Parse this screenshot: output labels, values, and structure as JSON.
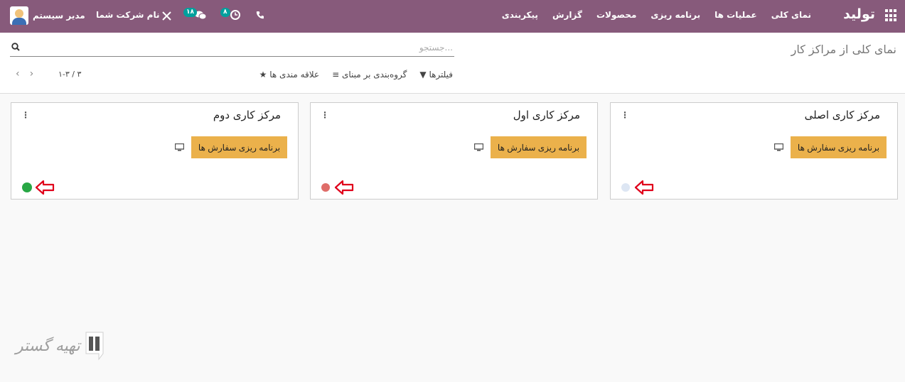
{
  "app": {
    "brand": "تولید",
    "menu": [
      "نمای کلی",
      "عملیات ها",
      "برنامه ریزی",
      "محصولات",
      "گزارش",
      "پیکربندی"
    ]
  },
  "systray": {
    "user_name": "مدیر سیستم",
    "company": "نام شرکت شما",
    "messages_badge": "۱۸",
    "activities_badge": "۸"
  },
  "control_panel": {
    "breadcrumb": "نمای کلی از مراکز کار",
    "search_placeholder": "جستجو...",
    "filters_label": "فیلترها",
    "groupby_label": "گروه‌بندی بر مبنای",
    "favorites_label": "علاقه مندی ها",
    "pager": "۱-۳ / ۳"
  },
  "cards": [
    {
      "title": "مرکز کاری اصلی",
      "button": "برنامه ریزی سفارش ها",
      "status_color": "#dde6f3"
    },
    {
      "title": "مرکز کاری اول",
      "button": "برنامه ریزی سفارش ها",
      "status_color": "#d9534f"
    },
    {
      "title": "مرکز کاری دوم",
      "button": "برنامه ریزی سفارش ها",
      "status_color": "#28a745"
    }
  ],
  "watermark": {
    "text": "تهیه گستر"
  }
}
